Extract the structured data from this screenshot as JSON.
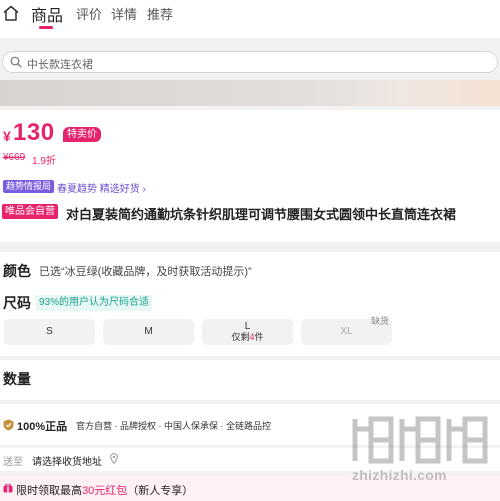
{
  "header": {
    "tabs": [
      {
        "label": "商品",
        "active": true
      },
      {
        "label": "评价",
        "active": false
      },
      {
        "label": "详情",
        "active": false
      },
      {
        "label": "推荐",
        "active": false
      }
    ],
    "home_icon": "home-icon"
  },
  "search": {
    "placeholder": "中长款连衣裙",
    "icon": "search-icon"
  },
  "product": {
    "currency": "¥",
    "price": "130",
    "sale_tag": "特卖价",
    "original_price": "¥669",
    "discount": "1.9折",
    "trend_tag": "趋势情报局",
    "trend_text": "春夏趋势 精选好货 ›",
    "vip_tag": "唯品会自营",
    "title": "对白夏装简约通勤坑条针织肌理可调节腰围女式圆领中长直筒连衣裙"
  },
  "sku": {
    "color_label": "颜色",
    "color_value": "已选“冰豆绿(收藏品牌，及时获取活动提示)”",
    "size_label": "尺码",
    "size_hint": "93%的用户认为尺码合适",
    "sizes": [
      {
        "label": "S"
      },
      {
        "label": "M"
      },
      {
        "label": "L",
        "stock_prefix": "仅剩",
        "stock_num": "4",
        "stock_suffix": "件"
      },
      {
        "label": "XL",
        "out_tag": "缺货"
      }
    ]
  },
  "quantity": {
    "label": "数量"
  },
  "guarantee": {
    "main": "100%正品",
    "sub": "官方自营 · 品牌授权 · 中国人保承保 · 全链路品控",
    "icon": "shield-icon"
  },
  "address": {
    "label": "送至",
    "value": "请选择收货地址",
    "icon": "location-pin-icon"
  },
  "promo": {
    "text_a": "限时领取最高",
    "highlight": "30元红包",
    "text_b": "（新人专享）",
    "icon": "gift-icon"
  },
  "watermark": {
    "text": "zhizhizhi.com"
  },
  "colors": {
    "accent": "#e6246e",
    "trend": "#7a5ce0",
    "hint": "#1aa191"
  }
}
